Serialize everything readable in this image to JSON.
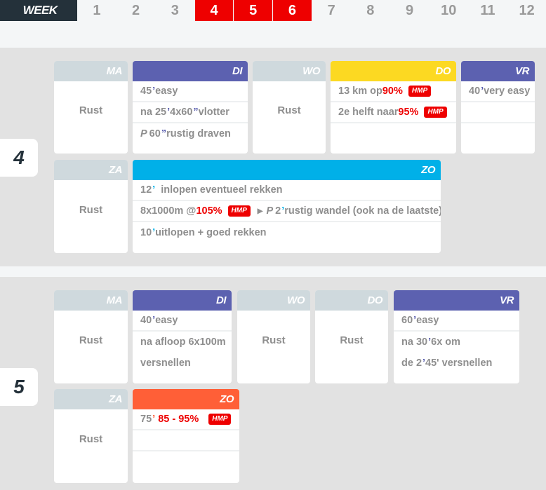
{
  "nav": {
    "label": "WEEK",
    "weeks": [
      "1",
      "2",
      "3",
      "4",
      "5",
      "6",
      "7",
      "8",
      "9",
      "10",
      "11",
      "12"
    ],
    "active_weeks": [
      "4",
      "5",
      "6"
    ]
  },
  "colors": {
    "accent_red": "#ee0000",
    "rest": "#cfd9dd",
    "purple": "#5c61b0",
    "yellow": "#fcd922",
    "blue": "#00b0e8",
    "orange": "#ff5f37",
    "dark": "#24313a"
  },
  "week4": {
    "number": "4",
    "days": {
      "ma": {
        "label": "MA",
        "text": "Rust"
      },
      "di": {
        "label": "DI",
        "lines": [
          {
            "a": "45",
            "b": " easy"
          },
          {
            "a": "na 25",
            "b": " 4x60",
            "c": " vlotter"
          },
          {
            "p": "P",
            "a": " 60",
            "c": " rustig draven"
          }
        ]
      },
      "wo": {
        "label": "WO",
        "text": "Rust"
      },
      "do": {
        "label": "DO",
        "lines": [
          {
            "a": "13 km op ",
            "r": "90%",
            "tag": "HMP"
          },
          {
            "a": "2e helft naar ",
            "r": "95%",
            "tag": "HMP"
          }
        ]
      },
      "vr": {
        "label": "VR",
        "lines": [
          {
            "a": "40",
            "b": " very easy"
          }
        ]
      },
      "za": {
        "label": "ZA",
        "text": "Rust"
      },
      "zo": {
        "label": "ZO",
        "lines": [
          {
            "a": "12",
            "b": "  inlopen eventueel rekken"
          },
          {
            "a": "8x1000m @",
            "r": "105%",
            "tag": "HMP",
            "p": "P",
            "c": " 2",
            "d": " rustig wandel (ook na de laatste)"
          },
          {
            "a": "10",
            "b": " uitlopen + goed rekken"
          }
        ]
      }
    }
  },
  "week5": {
    "number": "5",
    "days": {
      "ma": {
        "label": "MA",
        "text": "Rust"
      },
      "di": {
        "label": "DI",
        "lines": [
          {
            "a": "40",
            "b": " easy"
          },
          {
            "a": "na afloop 6x100m"
          },
          {
            "a": "versnellen"
          }
        ]
      },
      "wo": {
        "label": "WO",
        "text": "Rust"
      },
      "do": {
        "label": "DO",
        "text": "Rust"
      },
      "vr": {
        "label": "VR",
        "lines": [
          {
            "a": "60",
            "b": " easy"
          },
          {
            "a": "na 30",
            "b": " 6x om"
          },
          {
            "a": "de 2",
            "b": " 45' versnellen"
          }
        ]
      },
      "za": {
        "label": "ZA",
        "text": "Rust"
      },
      "zo": {
        "label": "ZO",
        "lines": [
          {
            "a": "75",
            "r": " 85 - 95%",
            "tag": "HMP"
          }
        ]
      }
    }
  }
}
